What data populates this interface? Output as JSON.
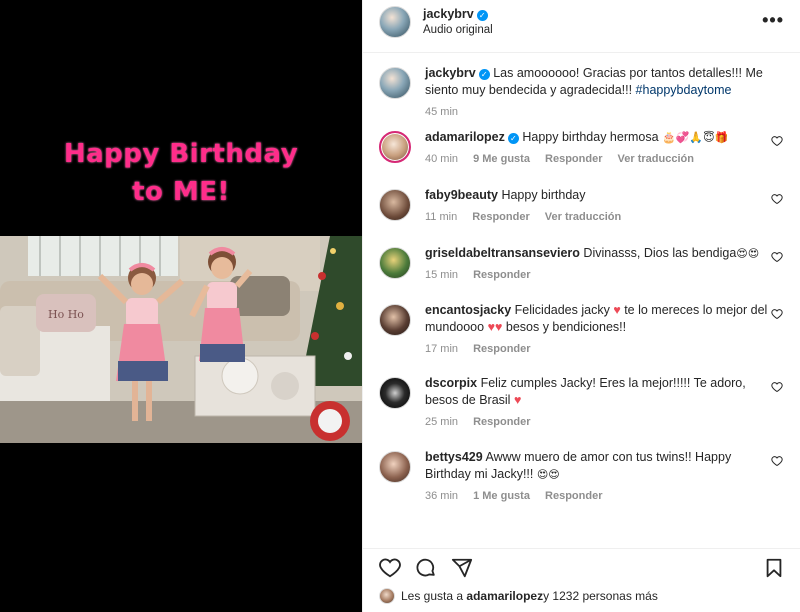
{
  "post": {
    "owner": "jackybrv",
    "audio": "Audio original",
    "overlay_line1": "Happy Birthday",
    "overlay_line2": "to ME!",
    "pillow_text": "Ho Ho"
  },
  "caption": {
    "user": "jackybrv",
    "text": "Las amoooooo! Gracias por tantos detalles!!! Me siento muy bendecida y agradecida!!! ",
    "hashtag": "#happybdaytome",
    "time": "45 min"
  },
  "comments": [
    {
      "user": "adamarilopez",
      "verified": true,
      "text": "Happy birthday hermosa ",
      "emojis": "🎂💞🙏😇🎁",
      "time": "40 min",
      "likes": "9 Me gusta",
      "reply": "Responder",
      "translate": "Ver traducción"
    },
    {
      "user": "faby9beauty",
      "verified": false,
      "text": "Happy birthday",
      "emojis": "",
      "time": "11 min",
      "likes": "",
      "reply": "Responder",
      "translate": "Ver traducción"
    },
    {
      "user": "griseldabeltransanseviero",
      "verified": false,
      "text": "Divinasss, Dios las bendiga",
      "emojis": "😍😍",
      "time": "15 min",
      "likes": "",
      "reply": "Responder",
      "translate": ""
    },
    {
      "user": "encantosjacky",
      "verified": false,
      "text_a": "Felicidades jacky ",
      "heart_a": "♥",
      "text_b": " te lo mereces lo mejor del mundoooo ",
      "heart_b": "♥♥",
      "text_c": " besos y bendiciones!!",
      "time": "17 min",
      "reply": "Responder"
    },
    {
      "user": "dscorpix",
      "verified": false,
      "text": "Feliz cumples Jacky! Eres la mejor!!!!! Te adoro, besos de Brasil ",
      "heart": "♥",
      "time": "25 min",
      "reply": "Responder"
    },
    {
      "user": "bettys429",
      "verified": false,
      "text": "Awww muero de amor con tus twins!! Happy Birthday mi Jacky!!! ",
      "emojis": "😍😍",
      "time": "36 min",
      "likes": "1 Me gusta",
      "reply": "Responder"
    }
  ],
  "likes": {
    "prefix": "Les gusta a ",
    "user": "adamarilopez",
    "suffix": " y 1232 personas más"
  },
  "colors": {
    "overlay_pink": "#ff2d8a",
    "verified_blue": "#0095f6",
    "heart_red": "#ed4956",
    "muted": "#8e8e8e"
  },
  "icons": [
    "more-options-icon",
    "heart-icon",
    "comment-icon",
    "share-icon",
    "bookmark-icon",
    "verified-icon"
  ]
}
